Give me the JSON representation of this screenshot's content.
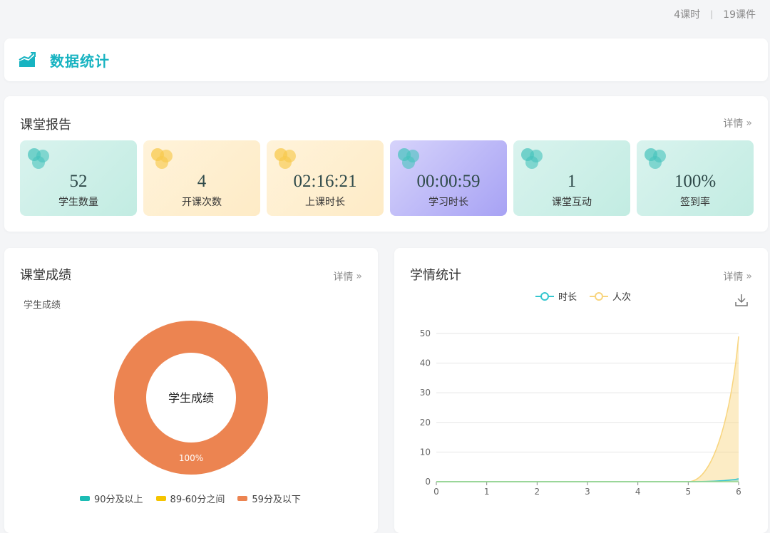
{
  "topbar": {
    "lessons": "4课时",
    "courseware": "19课件"
  },
  "header": {
    "title": "数据统计",
    "icon": "chart-trend-icon"
  },
  "report": {
    "title": "课堂报告",
    "detail": "详情",
    "stats": [
      {
        "value": "52",
        "label": "学生数量"
      },
      {
        "value": "4",
        "label": "开课次数"
      },
      {
        "value": "02:16:21",
        "label": "上课时长"
      },
      {
        "value": "00:00:59",
        "label": "学习时长"
      },
      {
        "value": "1",
        "label": "课堂互动"
      },
      {
        "value": "100%",
        "label": "签到率"
      }
    ]
  },
  "score": {
    "title": "课堂成绩",
    "detail": "详情",
    "subtitle": "学生成绩",
    "center_label": "学生成绩",
    "slice_label": "100%",
    "legend": [
      "90分及以上",
      "89-60分之间",
      "59分及以下"
    ],
    "colors": [
      "#1cbcb4",
      "#f5c400",
      "#ec8451"
    ]
  },
  "learning": {
    "title": "学情统计",
    "detail": "详情",
    "legend": [
      "时长",
      "人次"
    ],
    "colors": [
      "#34c6cf",
      "#f8d57e"
    ],
    "download_icon": "download-icon"
  },
  "chart_data": [
    {
      "type": "pie",
      "title": "学生成绩",
      "categories": [
        "90分及以上",
        "89-60分之间",
        "59分及以下"
      ],
      "values": [
        0,
        0,
        100
      ],
      "label": "100%"
    },
    {
      "type": "area",
      "x": [
        0,
        1,
        2,
        3,
        4,
        5,
        6
      ],
      "ylim": [
        0,
        50
      ],
      "yticks": [
        0,
        10,
        20,
        30,
        40,
        50
      ],
      "series": [
        {
          "name": "时长",
          "values": [
            0,
            0,
            0,
            0,
            0,
            0,
            1
          ]
        },
        {
          "name": "人次",
          "values": [
            0,
            0,
            0,
            0,
            0,
            0,
            49
          ]
        }
      ],
      "grid": true,
      "legend": "top"
    }
  ]
}
